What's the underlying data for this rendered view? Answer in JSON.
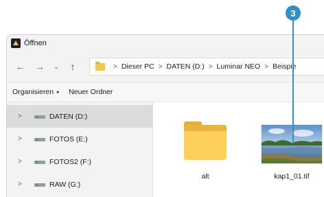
{
  "callout": {
    "number": "3"
  },
  "window": {
    "title": "Öffnen"
  },
  "nav": {
    "back": "←",
    "forward": "→",
    "recent": "⌄",
    "up": "↑"
  },
  "address": {
    "crumbs": [
      "Dieser PC",
      "DATEN (D:)",
      "Luminar NEO",
      "Beispie"
    ],
    "separator": ">"
  },
  "toolbar": {
    "organize": "Organisieren",
    "new_folder": "Neuer Ordner"
  },
  "sidebar": {
    "items": [
      {
        "label": "DATEN (D:)",
        "selected": true
      },
      {
        "label": "FOTOS (E:)",
        "selected": false
      },
      {
        "label": "FOTOS2 (F:)",
        "selected": false
      },
      {
        "label": "RAW (G:)",
        "selected": false
      }
    ],
    "chevron": ">"
  },
  "files": [
    {
      "name": "alt",
      "type": "folder-icon"
    },
    {
      "name": "kap1_01.tif",
      "type": "image-thumbnail"
    }
  ],
  "colors": {
    "accent": "#2f8fc6",
    "folder": "#ffcf5c",
    "selection": "#dcdcdc"
  }
}
